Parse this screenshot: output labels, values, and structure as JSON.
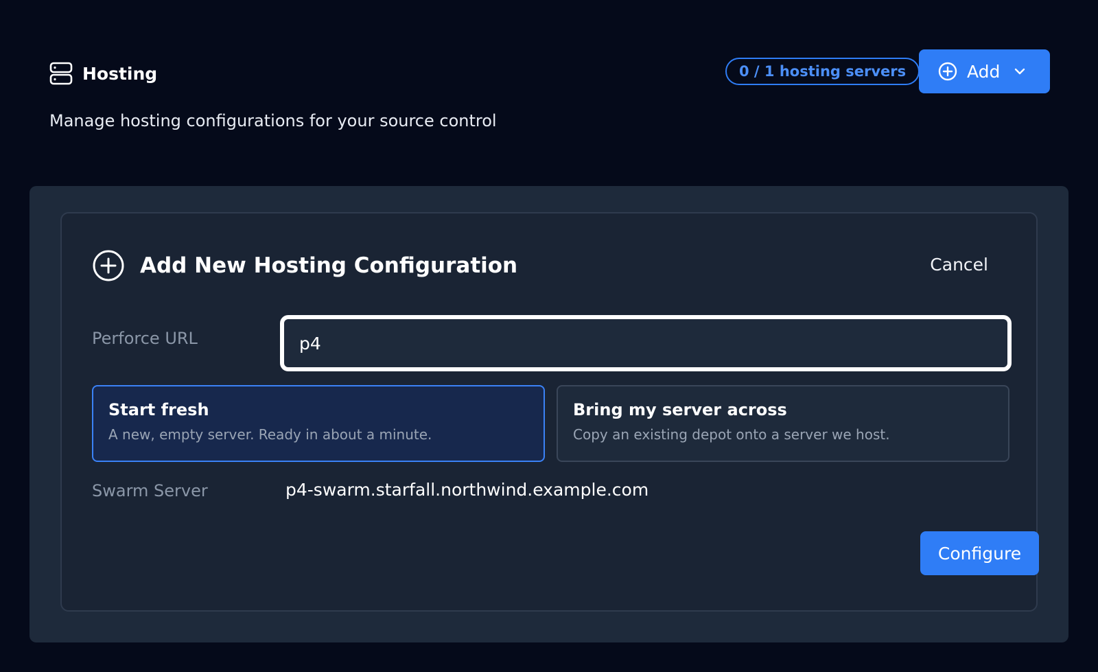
{
  "header": {
    "title": "Hosting",
    "icon": "server-icon",
    "badge": "0 / 1 hosting servers",
    "add_button": {
      "label": "Add",
      "icon": "plus-circle-icon",
      "chevron": "chevron-down-icon"
    }
  },
  "subtitle": "Manage hosting configurations for your source control",
  "form": {
    "title": "Add New Hosting Configuration",
    "icon": "plus-circle-icon",
    "cancel_label": "Cancel",
    "perforce_url": {
      "label": "Perforce URL",
      "value": "p4"
    },
    "options": [
      {
        "title": "Start fresh",
        "description": "A new, empty server. Ready in about a minute.",
        "selected": true
      },
      {
        "title": "Bring my server across",
        "description": "Copy an existing depot onto a server we host.",
        "selected": false
      }
    ],
    "swarm_server": {
      "label": "Swarm Server",
      "value": "p4-swarm.starfall.northwind.example.com"
    },
    "configure_label": "Configure"
  },
  "colors": {
    "background": "#050a1a",
    "panel": "#1e2a3b",
    "card": "#1a2434",
    "accent": "#2f7df6",
    "selected_option_bg": "#17284d"
  }
}
